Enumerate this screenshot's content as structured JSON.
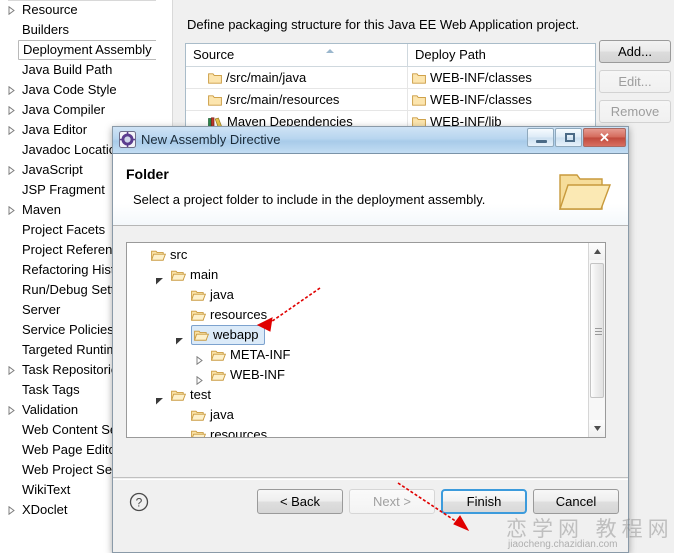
{
  "preferences": {
    "sidebar": {
      "items": [
        {
          "label": "Resource",
          "expandable": true,
          "selected": false
        },
        {
          "label": "Builders",
          "expandable": false,
          "selected": false
        },
        {
          "label": "Deployment Assembly",
          "expandable": false,
          "selected": true
        },
        {
          "label": "Java Build Path",
          "expandable": false,
          "selected": false
        },
        {
          "label": "Java Code Style",
          "expandable": true,
          "selected": false
        },
        {
          "label": "Java Compiler",
          "expandable": true,
          "selected": false
        },
        {
          "label": "Java Editor",
          "expandable": true,
          "selected": false
        },
        {
          "label": "Javadoc Location",
          "expandable": false,
          "selected": false
        },
        {
          "label": "JavaScript",
          "expandable": true,
          "selected": false
        },
        {
          "label": "JSP Fragment",
          "expandable": false,
          "selected": false
        },
        {
          "label": "Maven",
          "expandable": true,
          "selected": false
        },
        {
          "label": "Project Facets",
          "expandable": false,
          "selected": false
        },
        {
          "label": "Project References",
          "expandable": false,
          "selected": false
        },
        {
          "label": "Refactoring History",
          "expandable": false,
          "selected": false
        },
        {
          "label": "Run/Debug Settings",
          "expandable": false,
          "selected": false
        },
        {
          "label": "Server",
          "expandable": false,
          "selected": false
        },
        {
          "label": "Service Policies",
          "expandable": false,
          "selected": false
        },
        {
          "label": "Targeted Runtimes",
          "expandable": false,
          "selected": false
        },
        {
          "label": "Task Repositories",
          "expandable": true,
          "selected": false
        },
        {
          "label": "Task Tags",
          "expandable": false,
          "selected": false
        },
        {
          "label": "Validation",
          "expandable": true,
          "selected": false
        },
        {
          "label": "Web Content Settings",
          "expandable": false,
          "selected": false
        },
        {
          "label": "Web Page Editor",
          "expandable": false,
          "selected": false
        },
        {
          "label": "Web Project Settings",
          "expandable": false,
          "selected": false
        },
        {
          "label": "WikiText",
          "expandable": false,
          "selected": false
        },
        {
          "label": "XDoclet",
          "expandable": true,
          "selected": false
        }
      ]
    },
    "description": "Define packaging structure for this Java EE Web Application project.",
    "table": {
      "columns": [
        "Source",
        "Deploy Path"
      ],
      "sorted_column": "Source",
      "sort_direction": "asc",
      "rows": [
        {
          "source": "/src/main/java",
          "source_icon": "folder-icon",
          "deploy": "WEB-INF/classes",
          "deploy_icon": "folder-icon"
        },
        {
          "source": "/src/main/resources",
          "source_icon": "folder-icon",
          "deploy": "WEB-INF/classes",
          "deploy_icon": "folder-icon"
        },
        {
          "source": "Maven Dependencies",
          "source_icon": "library-icon",
          "deploy": "WEB-INF/lib",
          "deploy_icon": "folder-icon"
        }
      ]
    },
    "side_buttons": [
      {
        "label": "Add...",
        "enabled": true
      },
      {
        "label": "Edit...",
        "enabled": false
      },
      {
        "label": "Remove",
        "enabled": false
      }
    ]
  },
  "dialog": {
    "title": "New Assembly Directive",
    "app_icon": "eclipse-gear-icon",
    "window_buttons": [
      {
        "name": "minimize-button",
        "glyph": "minimize-icon"
      },
      {
        "name": "maximize-button",
        "glyph": "maximize-icon"
      },
      {
        "name": "close-button",
        "glyph": "close-icon",
        "label": "✕"
      }
    ],
    "heading": "Folder",
    "subtitle": "Select a project folder to include in the deployment assembly.",
    "header_icon": "open-folder-icon",
    "tree": [
      {
        "label": "src",
        "indent": 0,
        "expander": "none",
        "selected": false
      },
      {
        "label": "main",
        "indent": 1,
        "expander": "expanded",
        "selected": false
      },
      {
        "label": "java",
        "indent": 2,
        "expander": "none",
        "selected": false
      },
      {
        "label": "resources",
        "indent": 2,
        "expander": "none",
        "selected": false
      },
      {
        "label": "webapp",
        "indent": 2,
        "expander": "expanded",
        "selected": true
      },
      {
        "label": "META-INF",
        "indent": 3,
        "expander": "collapsed",
        "selected": false
      },
      {
        "label": "WEB-INF",
        "indent": 3,
        "expander": "collapsed",
        "selected": false
      },
      {
        "label": "test",
        "indent": 1,
        "expander": "expanded",
        "selected": false
      },
      {
        "label": "java",
        "indent": 2,
        "expander": "none",
        "selected": false
      },
      {
        "label": "resources",
        "indent": 2,
        "expander": "none",
        "selected": false
      }
    ],
    "help_icon": "question-mark-icon",
    "buttons": [
      {
        "label": "< Back",
        "enabled": true,
        "default": false,
        "name": "back-button"
      },
      {
        "label": "Next >",
        "enabled": false,
        "default": false,
        "name": "next-button"
      },
      {
        "label": "Finish",
        "enabled": true,
        "default": true,
        "name": "finish-button"
      },
      {
        "label": "Cancel",
        "enabled": true,
        "default": false,
        "name": "cancel-button"
      }
    ]
  },
  "annotations": {
    "arrow_color": "#e00000",
    "arrows": [
      {
        "name": "arrow-to-webapp",
        "points_to": "webapp"
      },
      {
        "name": "arrow-to-finish",
        "points_to": "Finish"
      }
    ]
  },
  "watermark": {
    "cn": "恋学网 教程网",
    "url": "jiaocheng.chazidian.com"
  }
}
